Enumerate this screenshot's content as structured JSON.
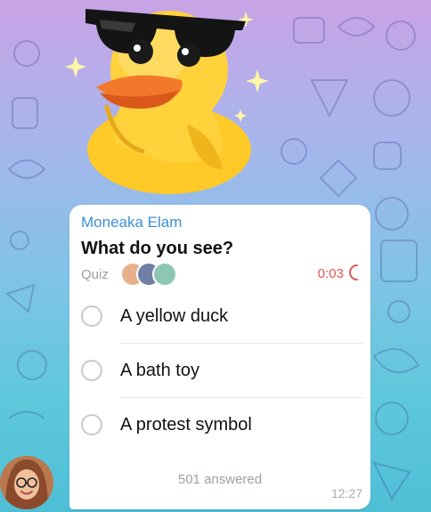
{
  "message": {
    "sender": "Moneaka Elam",
    "time": "12:27"
  },
  "poll": {
    "question": "What do you see?",
    "type_label": "Quiz",
    "timer": "0:03",
    "options": [
      {
        "label": "A yellow duck"
      },
      {
        "label": "A bath toy"
      },
      {
        "label": "A protest symbol"
      }
    ],
    "answered": "501 answered"
  },
  "icons": {
    "sticker": "duck-with-sunglasses",
    "timer": "timer-arc-icon",
    "avatar": "user-avatar"
  },
  "colors": {
    "sender_name": "#3d8fd6",
    "timer": "#e25555",
    "duck": "#ffc928",
    "beak": "#f2792b"
  }
}
